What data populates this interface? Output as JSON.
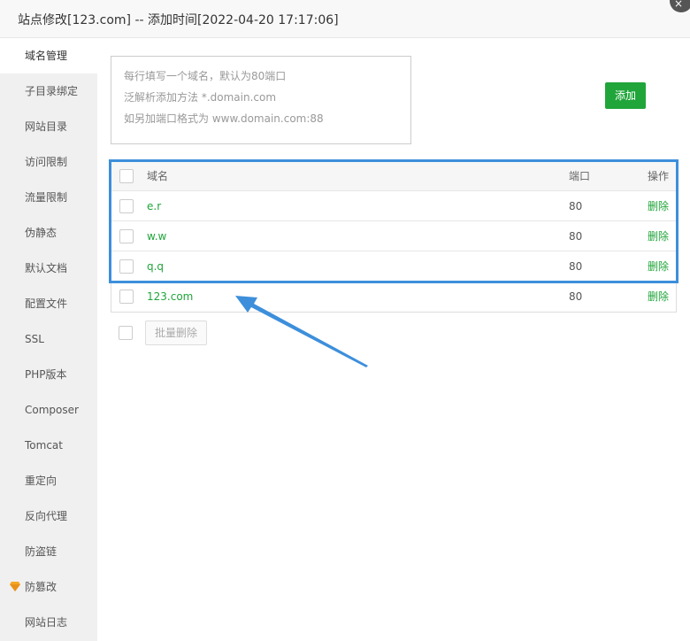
{
  "window": {
    "title": "站点修改[123.com] -- 添加时间[2022-04-20 17:17:06]",
    "close_glyph": "×"
  },
  "sidebar": {
    "items": [
      {
        "label": "域名管理",
        "active": true
      },
      {
        "label": "子目录绑定"
      },
      {
        "label": "网站目录"
      },
      {
        "label": "访问限制"
      },
      {
        "label": "流量限制"
      },
      {
        "label": "伪静态"
      },
      {
        "label": "默认文档"
      },
      {
        "label": "配置文件"
      },
      {
        "label": "SSL"
      },
      {
        "label": "PHP版本"
      },
      {
        "label": "Composer"
      },
      {
        "label": "Tomcat"
      },
      {
        "label": "重定向"
      },
      {
        "label": "反向代理"
      },
      {
        "label": "防盗链"
      },
      {
        "label": "防篡改",
        "icon": "gem-icon",
        "icon_color": "#f5a623"
      },
      {
        "label": "网站日志"
      }
    ]
  },
  "domain_input": {
    "placeholder_lines": [
      "每行填写一个域名，默认为80端口",
      "泛解析添加方法 *.domain.com",
      "如另加端口格式为 www.domain.com:88"
    ]
  },
  "add_button": {
    "label": "添加",
    "color": "#20a53a"
  },
  "table": {
    "headers": {
      "domain": "域名",
      "port": "端口",
      "action": "操作"
    },
    "rows": [
      {
        "domain": "e.r",
        "port": "80",
        "action": "删除"
      },
      {
        "domain": "w.w",
        "port": "80",
        "action": "删除"
      },
      {
        "domain": "q.q",
        "port": "80",
        "action": "删除"
      },
      {
        "domain": "123.com",
        "port": "80",
        "action": "删除"
      }
    ]
  },
  "batch_delete": {
    "label": "批量删除"
  },
  "annotation": {
    "highlight_color": "#3d8fdb"
  }
}
